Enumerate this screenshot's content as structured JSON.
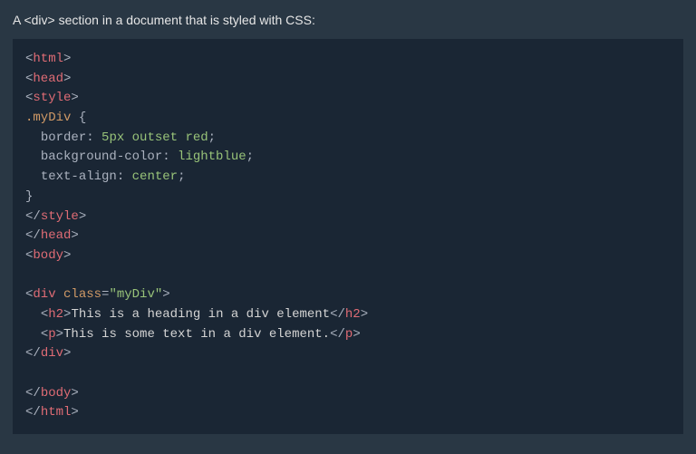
{
  "caption": "A <div> section in a document that is styled with CSS:",
  "code": {
    "tags": {
      "html": "html",
      "head": "head",
      "style": "style",
      "body": "body",
      "div": "div",
      "h2": "h2",
      "p": "p"
    },
    "css": {
      "selector": ".myDiv",
      "open_brace": "{",
      "close_brace": "}",
      "rules": {
        "border_prop": "border",
        "border_val": "5px outset red",
        "bg_prop": "background-color",
        "bg_val": "lightblue",
        "ta_prop": "text-align",
        "ta_val": "center"
      }
    },
    "attr": {
      "class_name": "class",
      "class_val": "\"myDiv\""
    },
    "content": {
      "h2_text": "This is a heading in a div element",
      "p_text": "This is some text in a div element."
    }
  }
}
